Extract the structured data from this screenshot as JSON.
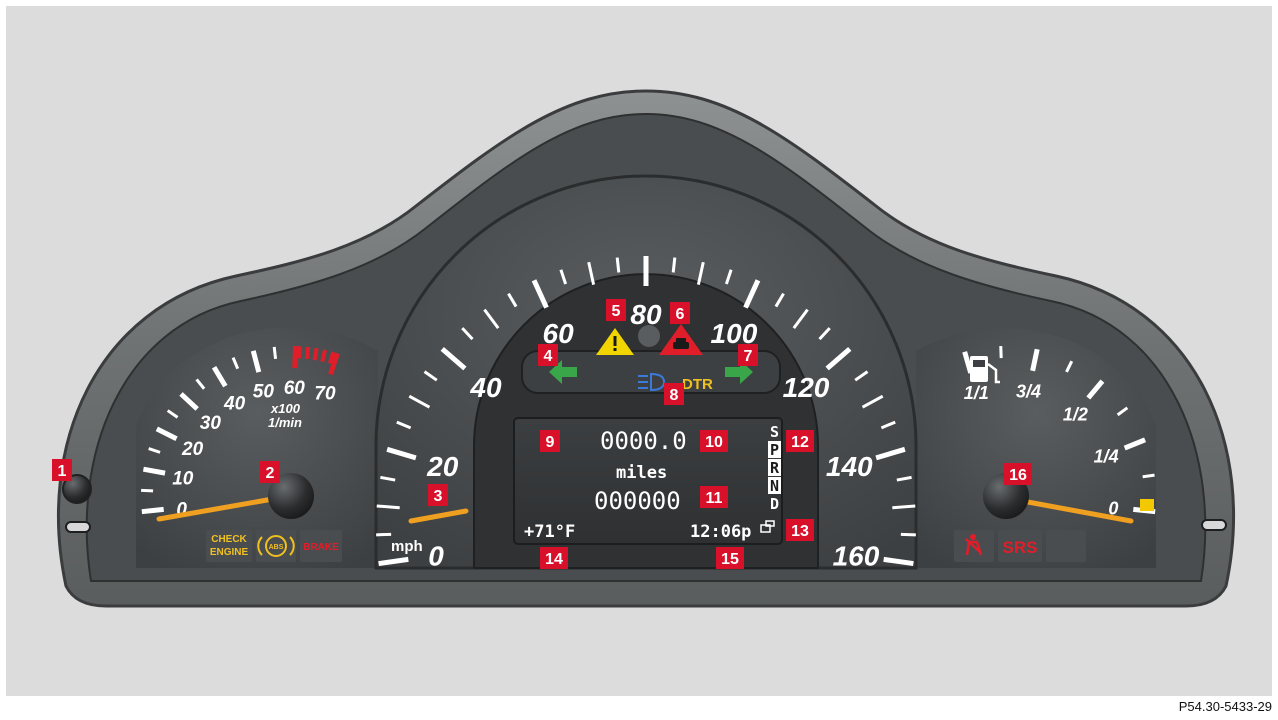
{
  "speedometer": {
    "labels": [
      "0",
      "20",
      "40",
      "60",
      "80",
      "100",
      "120",
      "140",
      "160"
    ],
    "unit": "mph",
    "needle_value": 0
  },
  "tachometer": {
    "labels": [
      "0",
      "10",
      "20",
      "30",
      "40",
      "50",
      "60",
      "70"
    ],
    "unit_line1": "x100",
    "unit_line2": "1/min",
    "redline_from": 60,
    "needle_value": 0
  },
  "fuel_gauge": {
    "labels": [
      "0",
      "1/4",
      "1/2",
      "3/4",
      "1/1"
    ],
    "needle_value": 0
  },
  "warning_lamps": {
    "check_engine_line1": "CHECK",
    "check_engine_line2": "ENGINE",
    "abs": "ABS",
    "brake": "BRAKE",
    "srs": "SRS",
    "dtr": "DTR"
  },
  "display": {
    "trip_odometer": "0000.0",
    "unit": "miles",
    "odometer": "000000",
    "outside_temp": "+71°F",
    "clock": "12:06p",
    "gear_positions": [
      "S",
      "P",
      "R",
      "N",
      "D"
    ]
  },
  "callouts": [
    "1",
    "2",
    "3",
    "4",
    "5",
    "6",
    "7",
    "8",
    "9",
    "10",
    "11",
    "12",
    "13",
    "14",
    "15",
    "16"
  ],
  "figure_reference": "P54.30-5433-29",
  "colors": {
    "needle": "#f0a020",
    "callout": "#d8102a",
    "turn_signal": "#3aa64a",
    "warning_yellow": "#f2d400",
    "warning_red": "#e01e2a",
    "high_beam": "#3a7ad8",
    "dtr": "#f0c020"
  }
}
